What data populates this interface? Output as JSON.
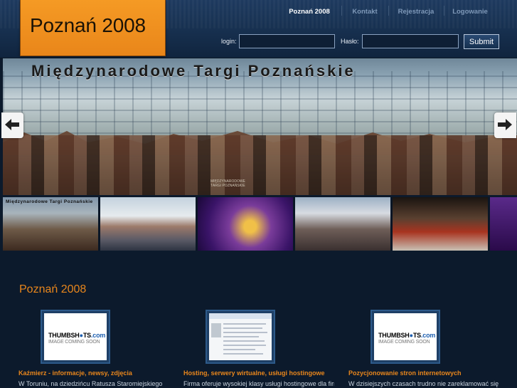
{
  "header": {
    "logo_text": "Poznań 2008",
    "nav": [
      {
        "label": "Poznań 2008",
        "active": true
      },
      {
        "label": "Kontakt",
        "active": false
      },
      {
        "label": "Rejestracja",
        "active": false
      },
      {
        "label": "Logowanie",
        "active": false
      }
    ],
    "login": {
      "login_label": "login:",
      "password_label": "Hasło:",
      "login_value": "",
      "password_value": "",
      "submit_label": "Submit"
    }
  },
  "slider": {
    "sign_text": "Międzynarodowe Targi Poznańskie",
    "caption_line1": "MIĘDZYNARODOWE",
    "caption_line2": "TARGI POZNAŃSKIE",
    "thumb_sign_text": "Międzynarodowe Targi Poznańskie"
  },
  "main": {
    "section_title": "Poznań 2008",
    "cards": [
      {
        "title": "Kaźmierz - informacje, newsy, zdjęcia",
        "text": "W Toruniu, na dziedzińcu Ratusza Staromiejskiego",
        "thumb_brand_a": "THUMBSH",
        "thumb_brand_b": "TS",
        "thumb_brand_c": ".com",
        "thumb_sub": "IMAGE COMING SOON"
      },
      {
        "title": "Hosting, serwery wirtualne, usługi hostingowe",
        "text": "Firma oferuje wysokiej klasy usługi hostingowe dla firm i"
      },
      {
        "title": "Pozycjonowanie stron internetowych",
        "text": "W dzisiejszych czasach trudno nie zareklamować się w",
        "thumb_brand_a": "THUMBSH",
        "thumb_brand_b": "TS",
        "thumb_brand_c": ".com",
        "thumb_sub": "IMAGE COMING SOON"
      }
    ]
  },
  "colors": {
    "accent": "#e8861c",
    "background": "#0c1a2c",
    "logo_bg": "#f59a24"
  },
  "icons": {
    "prev": "arrow-left-icon",
    "next": "arrow-right-icon"
  }
}
